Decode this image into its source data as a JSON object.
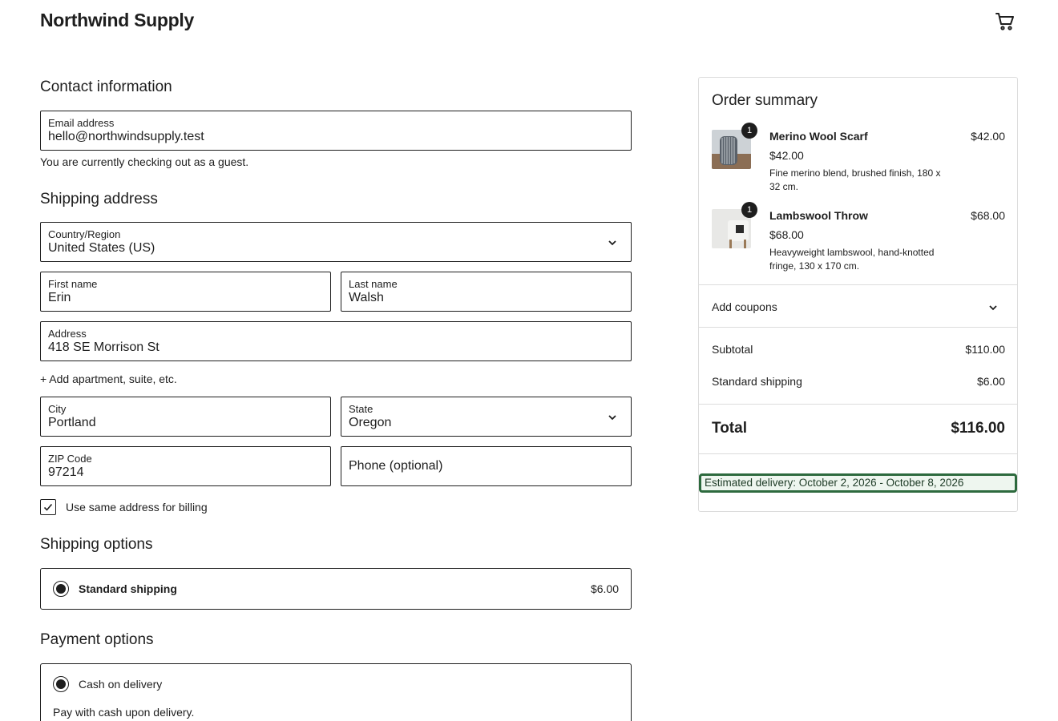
{
  "header": {
    "brand": "Northwind Supply"
  },
  "contact": {
    "title": "Contact information",
    "email_label": "Email address",
    "email_value": "hello@northwindsupply.test",
    "guest_note": "You are currently checking out as a guest."
  },
  "shipping_address": {
    "title": "Shipping address",
    "country_label": "Country/Region",
    "country_value": "United States (US)",
    "first_name_label": "First name",
    "first_name_value": "Erin",
    "last_name_label": "Last name",
    "last_name_value": "Walsh",
    "address_label": "Address",
    "address_value": "418 SE Morrison St",
    "add_apartment": "+ Add apartment, suite, etc.",
    "city_label": "City",
    "city_value": "Portland",
    "state_label": "State",
    "state_value": "Oregon",
    "zip_label": "ZIP Code",
    "zip_value": "97214",
    "phone_placeholder": "Phone (optional)",
    "billing_same_label": "Use same address for billing",
    "billing_same_checked": true
  },
  "shipping_options": {
    "title": "Shipping options",
    "options": [
      {
        "label": "Standard shipping",
        "price": "$6.00",
        "selected": true
      }
    ]
  },
  "payment_options": {
    "title": "Payment options",
    "options": [
      {
        "label": "Cash on delivery",
        "description": "Pay with cash upon delivery.",
        "selected": true
      }
    ]
  },
  "summary": {
    "title": "Order summary",
    "items": [
      {
        "name": "Merino Wool Scarf",
        "qty": "1",
        "price": "$42.00",
        "line_total": "$42.00",
        "description": "Fine merino blend, brushed finish, 180 x 32 cm."
      },
      {
        "name": "Lambswool Throw",
        "qty": "1",
        "price": "$68.00",
        "line_total": "$68.00",
        "description": "Heavyweight lambswool, hand-knotted fringe, 130 x 170 cm."
      }
    ],
    "coupons_label": "Add coupons",
    "subtotal_label": "Subtotal",
    "subtotal_value": "$110.00",
    "shipping_label": "Standard shipping",
    "shipping_value": "$6.00",
    "total_label": "Total",
    "total_value": "$116.00",
    "estimated_delivery": "Estimated delivery: October 2, 2026 - October 8, 2026"
  },
  "colors": {
    "text": "#1e1e1e",
    "border_light": "#dcdcdc",
    "delivery_border": "#2d6a3e"
  }
}
